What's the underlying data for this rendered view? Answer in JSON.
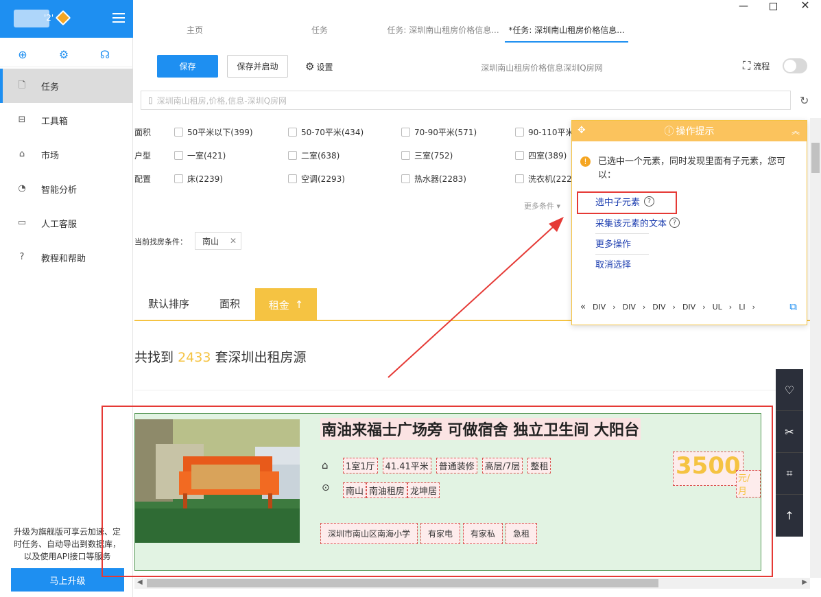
{
  "sidebar": {
    "user_suffix": "'2'",
    "nav": [
      {
        "label": "任务",
        "icon": "document-icon",
        "glyph": "🗋"
      },
      {
        "label": "工具箱",
        "icon": "toolbox-icon",
        "glyph": "⊟"
      },
      {
        "label": "市场",
        "icon": "bag-icon",
        "glyph": "⌂"
      },
      {
        "label": "智能分析",
        "icon": "pie-chart-icon",
        "glyph": "◔"
      },
      {
        "label": "人工客服",
        "icon": "chat-icon",
        "glyph": "▭"
      },
      {
        "label": "教程和帮助",
        "icon": "help-icon",
        "glyph": "?"
      }
    ],
    "upgrade_text": "升级为旗舰版可享云加速、定时任务、自动导出到数据库，以及使用API接口等服务",
    "upgrade_button": "马上升级"
  },
  "tabs": [
    "主页",
    "任务",
    "任务: 深圳南山租房价格信息...",
    "*任务: 深圳南山租房价格信息..."
  ],
  "toolbar": {
    "save": "保存",
    "save_run": "保存并启动",
    "settings": "设置",
    "page_title": "深圳南山租房价格信息深圳Q房网",
    "flow": "流程"
  },
  "url": "深圳南山租房,价格,信息-深圳Q房网",
  "filters": [
    {
      "label": "面积",
      "options": [
        "50平米以下(399)",
        "50-70平米(434)",
        "70-90平米(571)",
        "90-110平米"
      ]
    },
    {
      "label": "户型",
      "options": [
        "一室(421)",
        "二室(638)",
        "三室(752)",
        "四室(389)"
      ]
    },
    {
      "label": "配置",
      "options": [
        "床(2239)",
        "空调(2293)",
        "热水器(2283)",
        "洗衣机(222"
      ]
    }
  ],
  "more_conditions": "更多条件",
  "current_condition_label": "当前找房条件：",
  "current_condition_tag": "南山",
  "sort": {
    "default": "默认排序",
    "area": "面积",
    "rent": "租金"
  },
  "found": {
    "prefix": "共找到",
    "count": "2433",
    "suffix": "套深圳出租房源"
  },
  "listing": {
    "title": "南油来福士广场旁 可做宿舍 独立卫生间 大阳台",
    "specs": [
      "1室1厅",
      "41.41平米",
      "普通装修",
      "高层/7层",
      "整租"
    ],
    "location": [
      "南山",
      "南油租房",
      "龙坤居"
    ],
    "tags": [
      "深圳市南山区南海小学",
      "有家电",
      "有家私",
      "急租"
    ],
    "price": "3500",
    "price_unit": "元/月"
  },
  "tip": {
    "title": "操作提示",
    "message": "已选中一个元素，同时发现里面有子元素，您可以：",
    "links": [
      "选中子元素",
      "采集该元素的文本",
      "更多操作",
      "取消选择"
    ],
    "path": [
      "DIV",
      "DIV",
      "DIV",
      "DIV",
      "UL",
      "LI"
    ]
  },
  "colors": {
    "accent": "#1e8ff1",
    "highlight": "#e53935",
    "gold": "#f5c342"
  }
}
